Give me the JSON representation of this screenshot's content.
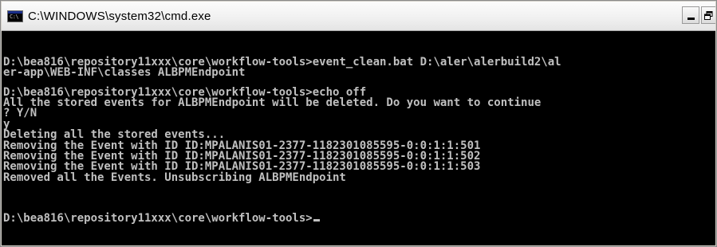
{
  "window": {
    "title": "C:\\WINDOWS\\system32\\cmd.exe",
    "app_icon_text": "C:\\"
  },
  "console": {
    "blocks": [
      [
        "D:\\bea816\\repository11xxx\\core\\workflow-tools>event_clean.bat D:\\aler\\alerbuild2\\al",
        "er-app\\WEB-INF\\classes ALBPMEndpoint"
      ],
      [
        "D:\\bea816\\repository11xxx\\core\\workflow-tools>echo off",
        "All the stored events for ALBPMEndpoint will be deleted. Do you want to continue",
        "? Y/N",
        "y",
        "Deleting all the stored events...",
        "Removing the Event with ID ID:MPALANIS01-2377-1182301085595-0:0:1:1:501",
        "Removing the Event with ID ID:MPALANIS01-2377-1182301085595-0:0:1:1:502",
        "Removing the Event with ID ID:MPALANIS01-2377-1182301085595-0:0:1:1:503",
        "Removed all the Events. Unsubscribing ALBPMEndpoint"
      ]
    ],
    "prompt": "D:\\bea816\\repository11xxx\\core\\workflow-tools>"
  },
  "colors": {
    "console_bg": "#000000",
    "console_fg": "#c0c0c0",
    "titlebar": "#f1f1f1"
  }
}
